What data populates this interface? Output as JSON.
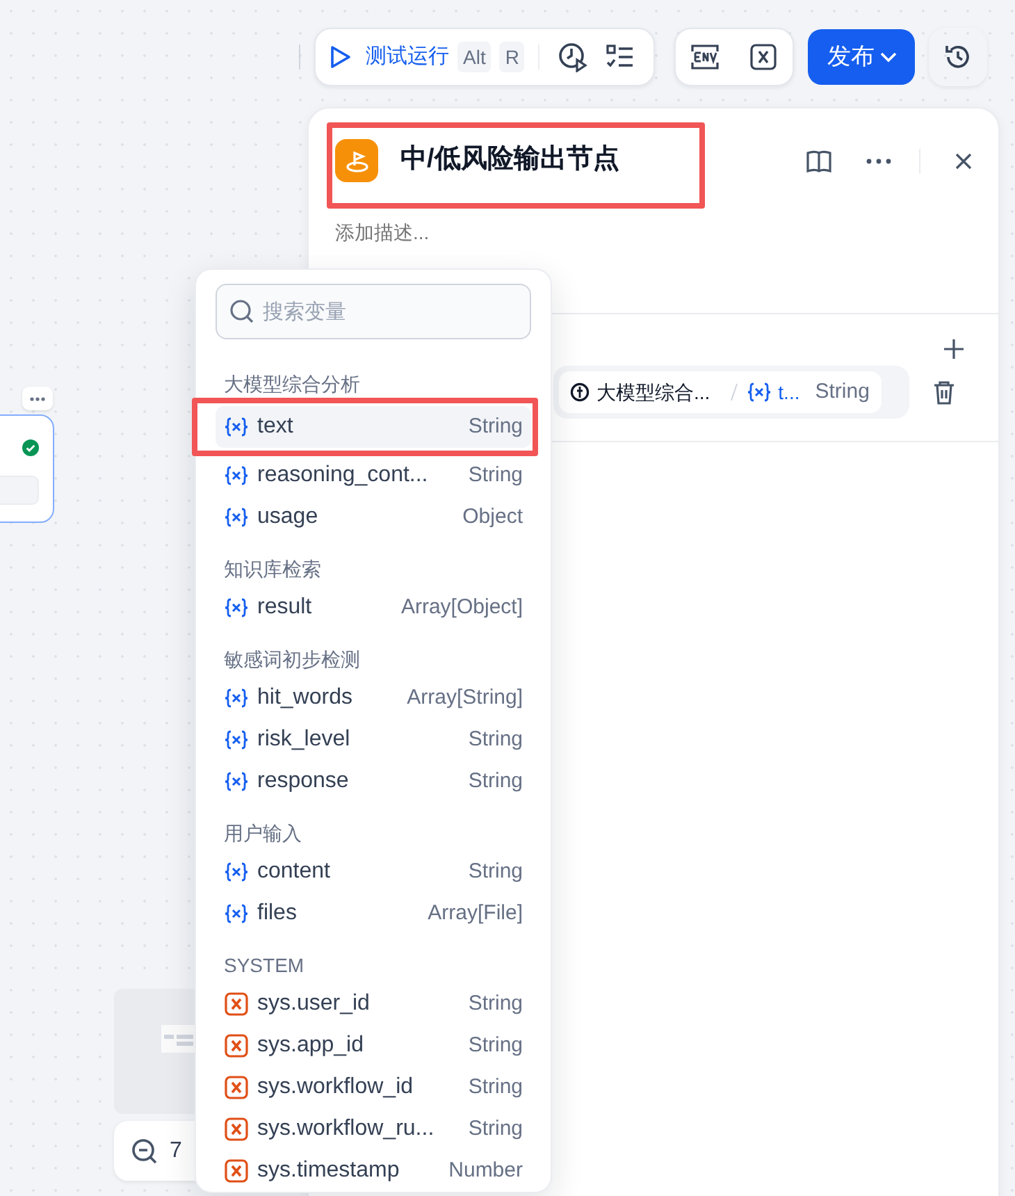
{
  "toolbar": {
    "test_run": {
      "label": "测试运行",
      "shortcut": [
        "Alt",
        "R"
      ]
    },
    "publish": {
      "label": "发布"
    }
  },
  "node_panel": {
    "title": "中/低风险输出节点",
    "description": {
      "placeholder": "添加描述..."
    },
    "variable": {
      "source": "大模型综合...",
      "name": "t...",
      "type": "String"
    }
  },
  "canvas": {
    "zoom": "7"
  },
  "variable_picker": {
    "search": {
      "placeholder": "搜索变量"
    },
    "groups": [
      {
        "label": "大模型综合分析",
        "items": [
          {
            "kind": "variable",
            "name": "text",
            "type": "String",
            "selected": true
          },
          {
            "kind": "variable",
            "name": "reasoning_cont...",
            "type": "String",
            "selected": false
          },
          {
            "kind": "variable",
            "name": "usage",
            "type": "Object",
            "selected": false
          }
        ]
      },
      {
        "label": "知识库检索",
        "items": [
          {
            "kind": "variable",
            "name": "result",
            "type": "Array[Object]",
            "selected": false
          }
        ]
      },
      {
        "label": "敏感词初步检测",
        "items": [
          {
            "kind": "variable",
            "name": "hit_words",
            "type": "Array[String]",
            "selected": false
          },
          {
            "kind": "variable",
            "name": "risk_level",
            "type": "String",
            "selected": false
          },
          {
            "kind": "variable",
            "name": "response",
            "type": "String",
            "selected": false
          }
        ]
      },
      {
        "label": "用户输入",
        "items": [
          {
            "kind": "variable",
            "name": "content",
            "type": "String",
            "selected": false
          },
          {
            "kind": "variable",
            "name": "files",
            "type": "Array[File]",
            "selected": false
          }
        ]
      },
      {
        "label": "SYSTEM",
        "items": [
          {
            "kind": "system",
            "name": "sys.user_id",
            "type": "String",
            "selected": false
          },
          {
            "kind": "system",
            "name": "sys.app_id",
            "type": "String",
            "selected": false
          },
          {
            "kind": "system",
            "name": "sys.workflow_id",
            "type": "String",
            "selected": false
          },
          {
            "kind": "system",
            "name": "sys.workflow_ru...",
            "type": "String",
            "selected": false
          },
          {
            "kind": "system",
            "name": "sys.timestamp",
            "type": "Number",
            "selected": false
          }
        ]
      }
    ]
  }
}
